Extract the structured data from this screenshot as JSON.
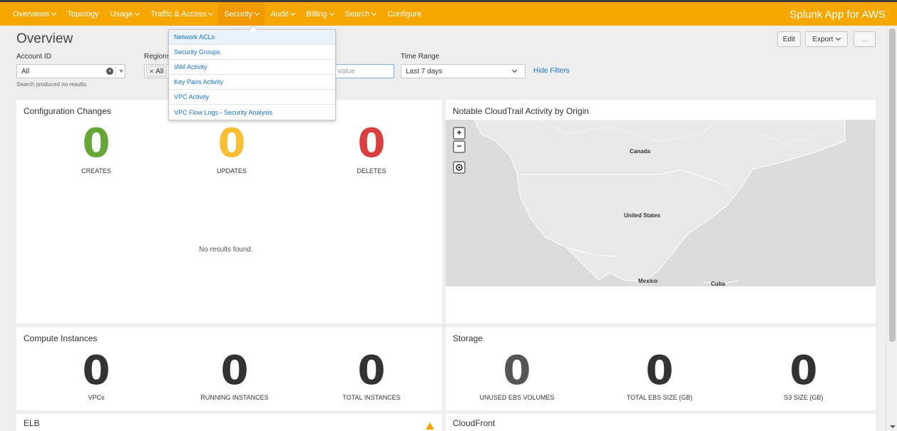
{
  "nav": {
    "items": [
      {
        "label": "Overviews",
        "chevron": true
      },
      {
        "label": "Topology",
        "chevron": false
      },
      {
        "label": "Usage",
        "chevron": true
      },
      {
        "label": "Traffic & Access",
        "chevron": true
      },
      {
        "label": "Security",
        "chevron": true
      },
      {
        "label": "Audit",
        "chevron": true
      },
      {
        "label": "Billing",
        "chevron": true
      },
      {
        "label": "Search",
        "chevron": true
      },
      {
        "label": "Configure",
        "chevron": false
      }
    ],
    "app_title": "Splunk App for AWS",
    "bar_color": "#f7a800"
  },
  "header": {
    "title": "Overview",
    "edit_label": "Edit",
    "export_label": "Export",
    "more_label": "..."
  },
  "filters": {
    "account_label": "Account ID",
    "account_value": "All",
    "regions_label": "Regions",
    "regions_chip": "All",
    "text_placeholder": "value",
    "time_label": "Time Range",
    "time_value": "Last 7 days",
    "hide_filters": "Hide Filters",
    "note": "Search produced no results."
  },
  "security_menu": {
    "items": [
      "Network ACLs",
      "Security Groups",
      "IAM Activity",
      "Key Pairs Activity",
      "VPC Activity",
      "VPC Flow Logs - Security Analysis"
    ]
  },
  "config_changes": {
    "title": "Configuration Changes",
    "metrics": [
      {
        "value": "0",
        "label": "CREATES",
        "color": "#65a637"
      },
      {
        "value": "0",
        "label": "UPDATES",
        "color": "#f8be34"
      },
      {
        "value": "0",
        "label": "DELETES",
        "color": "#d93f3c"
      }
    ],
    "no_results": "No results found."
  },
  "map_panel": {
    "title": "Notable CloudTrail Activity by Origin",
    "zoom_in": "+",
    "zoom_out": "−",
    "labels": [
      "Canada",
      "United States",
      "Mexico",
      "Cuba"
    ]
  },
  "compute": {
    "title": "Compute Instances",
    "metrics": [
      {
        "value": "0",
        "label": "VPCs"
      },
      {
        "value": "0",
        "label": "RUNNING INSTANCES"
      },
      {
        "value": "0",
        "label": "TOTAL INSTANCES"
      }
    ],
    "color": "#333333"
  },
  "storage": {
    "title": "Storage",
    "metrics": [
      {
        "value": "0",
        "label": "UNUSED EBS VOLUMES",
        "color": "#555555"
      },
      {
        "value": "0",
        "label": "TOTAL EBS SIZE (GB)",
        "color": "#333333"
      },
      {
        "value": "0",
        "label": "S3 SIZE (GB)",
        "color": "#333333"
      }
    ]
  },
  "elb": {
    "title": "ELB"
  },
  "cloudfront": {
    "title": "CloudFront"
  }
}
